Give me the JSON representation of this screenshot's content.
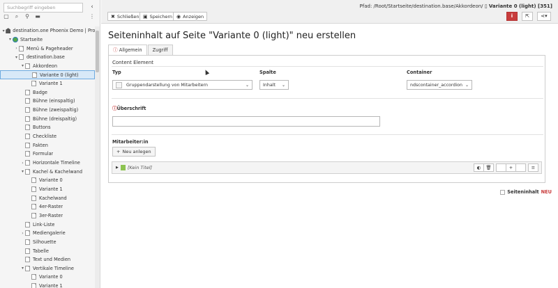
{
  "tree": {
    "search_placeholder": "Suchbegriff eingeben",
    "rows": [
      {
        "label": "destination.one Phoenix Demo | Product",
        "level": 0,
        "toggle": "▾",
        "icon": "root"
      },
      {
        "label": "Startseite",
        "level": 1,
        "toggle": "▾",
        "icon": "globe"
      },
      {
        "label": "Menü & Pageheader",
        "level": 2,
        "toggle": "›",
        "icon": "page"
      },
      {
        "label": "destination.base",
        "level": 2,
        "toggle": "▾",
        "icon": "page"
      },
      {
        "label": "Akkordeon",
        "level": 3,
        "toggle": "▾",
        "icon": "page"
      },
      {
        "label": "Variante 0 (light)",
        "level": 4,
        "toggle": "",
        "icon": "page",
        "selected": true
      },
      {
        "label": "Variante 1",
        "level": 4,
        "toggle": "",
        "icon": "page"
      },
      {
        "label": "Badge",
        "level": 3,
        "toggle": "",
        "icon": "page"
      },
      {
        "label": "Bühne (einspaltig)",
        "level": 3,
        "toggle": "",
        "icon": "page"
      },
      {
        "label": "Bühne (zweispaltig)",
        "level": 3,
        "toggle": "",
        "icon": "page"
      },
      {
        "label": "Bühne (dreispaltig)",
        "level": 3,
        "toggle": "",
        "icon": "page"
      },
      {
        "label": "Buttons",
        "level": 3,
        "toggle": "",
        "icon": "page"
      },
      {
        "label": "Checkliste",
        "level": 3,
        "toggle": "",
        "icon": "page"
      },
      {
        "label": "Fakten",
        "level": 3,
        "toggle": "",
        "icon": "page"
      },
      {
        "label": "Formular",
        "level": 3,
        "toggle": "",
        "icon": "page"
      },
      {
        "label": "Horizontale Timeline",
        "level": 3,
        "toggle": "›",
        "icon": "page"
      },
      {
        "label": "Kachel & Kachelwand",
        "level": 3,
        "toggle": "▾",
        "icon": "page"
      },
      {
        "label": "Variante 0",
        "level": 4,
        "toggle": "",
        "icon": "page"
      },
      {
        "label": "Variante 1",
        "level": 4,
        "toggle": "",
        "icon": "page"
      },
      {
        "label": "Kachelwand",
        "level": 4,
        "toggle": "",
        "icon": "page"
      },
      {
        "label": "4er-Raster",
        "level": 4,
        "toggle": "",
        "icon": "page"
      },
      {
        "label": "3er-Raster",
        "level": 4,
        "toggle": "",
        "icon": "page"
      },
      {
        "label": "Link-Liste",
        "level": 3,
        "toggle": "",
        "icon": "page"
      },
      {
        "label": "Mediengalerie",
        "level": 3,
        "toggle": "›",
        "icon": "page"
      },
      {
        "label": "Silhouette",
        "level": 3,
        "toggle": "",
        "icon": "page"
      },
      {
        "label": "Tabelle",
        "level": 3,
        "toggle": "",
        "icon": "page"
      },
      {
        "label": "Text und Medien",
        "level": 3,
        "toggle": "",
        "icon": "page"
      },
      {
        "label": "Vertikale Timeline",
        "level": 3,
        "toggle": "▾",
        "icon": "page"
      },
      {
        "label": "Variante 0",
        "level": 4,
        "toggle": "",
        "icon": "page"
      },
      {
        "label": "Variante 1",
        "level": 4,
        "toggle": "",
        "icon": "page"
      }
    ]
  },
  "toolbar": {
    "close_label": "Schließen",
    "save_label": "Speichern",
    "view_label": "Anzeigen",
    "path_prefix": "Pfad: /Root/Startseite/destination.base/Akkordeon/",
    "path_current": "Variante 0 (light) [351]",
    "info_label": "i"
  },
  "main": {
    "title": "Seiteninhalt auf Seite \"Variante 0 (light)\" neu erstellen",
    "tabs": [
      "Allgemein",
      "Zugriff"
    ],
    "section_content": "Content Element",
    "type_label": "Typ",
    "type_value": "Gruppendarstellung von Mitarbeitern",
    "column_label": "Spalte",
    "column_value": "Inhalt",
    "container_label": "Container",
    "container_value": "ndscontainer_accordion",
    "heading_label": "Überschrift",
    "heading_value": "",
    "staff_label": "Mitarbeiter:in",
    "new_button": "Neu anlegen",
    "record_title": "[Kein Titel]",
    "footer_label": "Seiteninhalt",
    "footer_new": "NEU"
  }
}
